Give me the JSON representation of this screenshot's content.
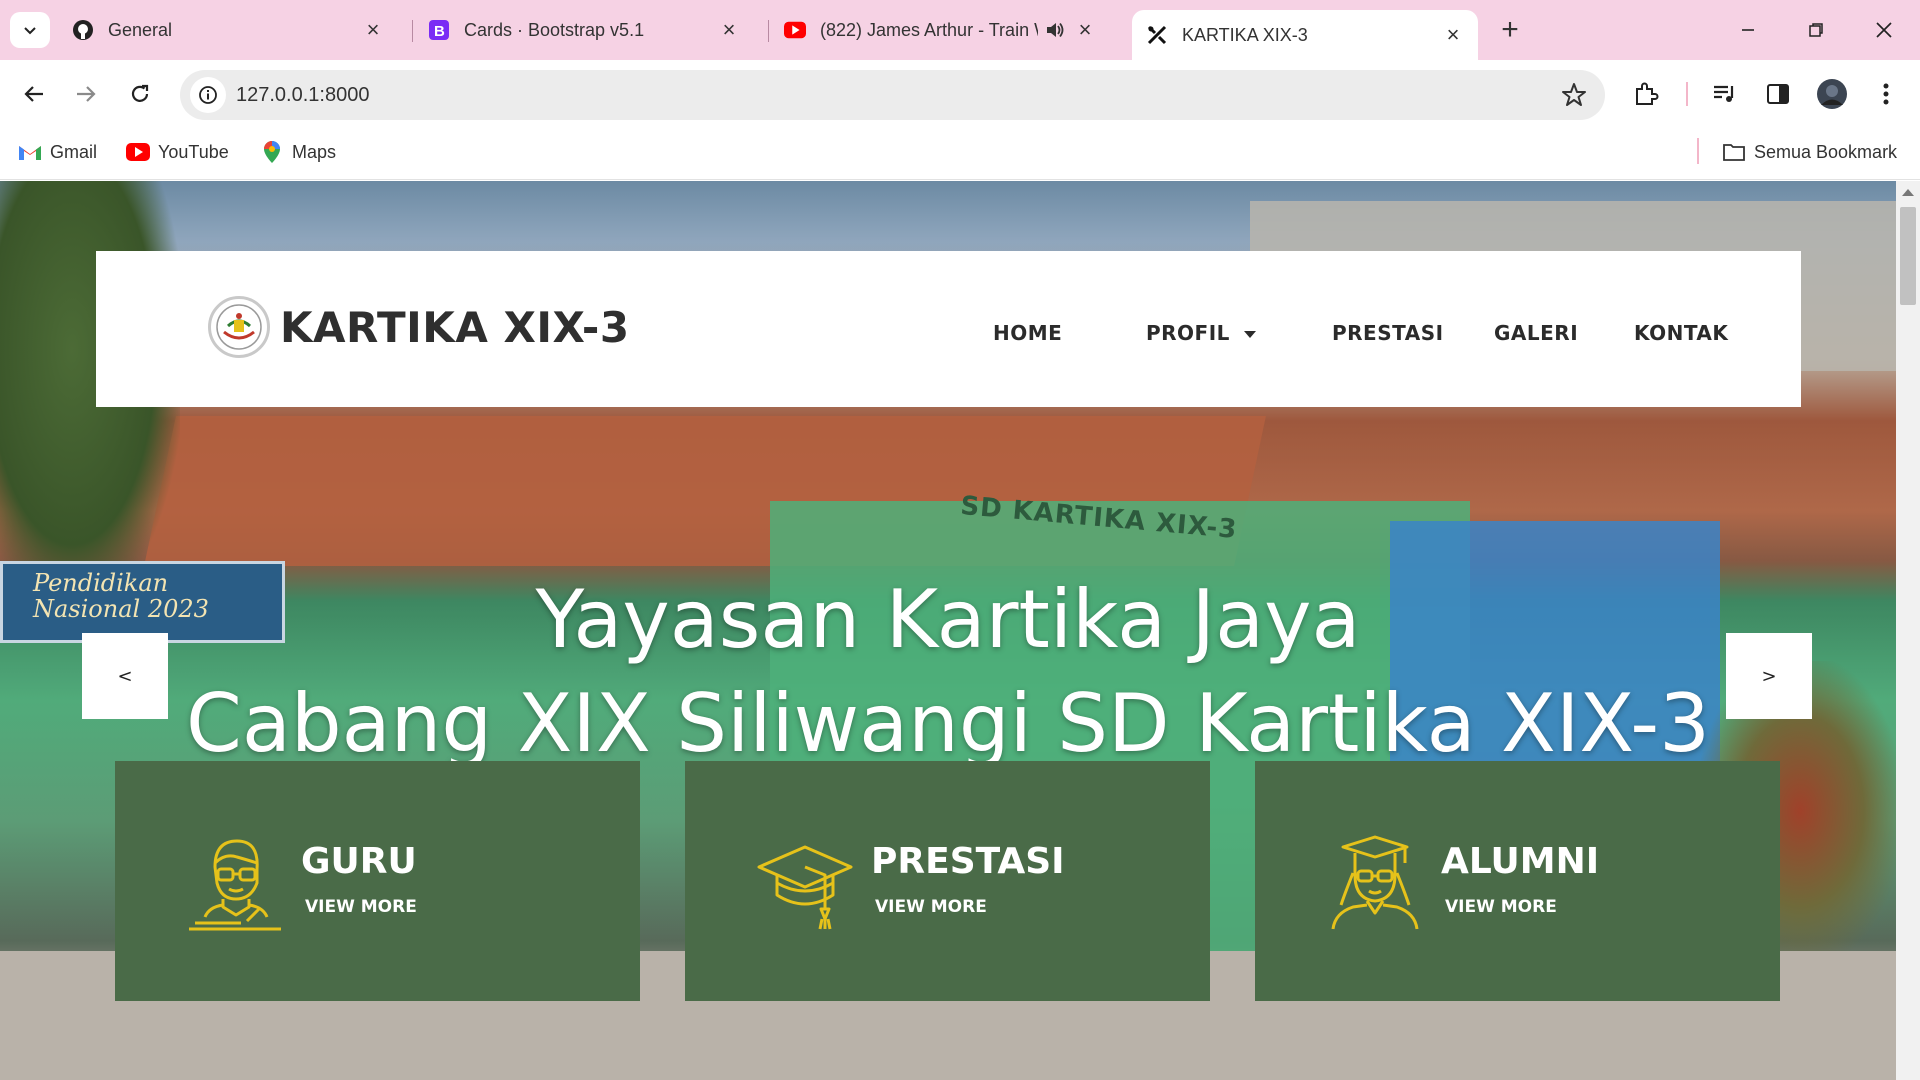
{
  "browser": {
    "tabs": [
      {
        "title": "General",
        "icon": "github-icon",
        "active": false
      },
      {
        "title": "Cards · Bootstrap v5.1",
        "icon": "bootstrap-icon",
        "active": false
      },
      {
        "title": "(822) James Arthur - Train W",
        "icon": "youtube-icon",
        "active": false,
        "audio": true
      },
      {
        "title": "KARTIKA XIX-3",
        "icon": "site-icon",
        "active": true
      }
    ],
    "url": "127.0.0.1:8000",
    "bookmarks": [
      {
        "label": "Gmail",
        "icon": "gmail-icon"
      },
      {
        "label": "YouTube",
        "icon": "youtube-icon"
      },
      {
        "label": "Maps",
        "icon": "maps-icon"
      }
    ],
    "all_bookmarks_label": "Semua Bookmark"
  },
  "site": {
    "brand": "KARTIKA XIX-3",
    "nav": [
      {
        "label": "HOME"
      },
      {
        "label": "PROFIL",
        "dropdown": true
      },
      {
        "label": "PRESTASI"
      },
      {
        "label": "GALERI"
      },
      {
        "label": "KONTAK"
      }
    ],
    "hero": {
      "line1": "Yayasan Kartika Jaya",
      "line2": "Cabang XIX Siliwangi SD Kartika XIX-3",
      "prev": "<",
      "next": ">"
    },
    "background_signs": {
      "school_sign": "SD KARTIKA XIX-3",
      "banner": "Pendidikan Nasional 2023"
    },
    "cards": [
      {
        "title": "GURU",
        "link": "VIEW MORE",
        "icon": "teacher-icon"
      },
      {
        "title": "PRESTASI",
        "link": "VIEW MORE",
        "icon": "graduation-cap-icon"
      },
      {
        "title": "ALUMNI",
        "link": "VIEW MORE",
        "icon": "graduate-icon"
      }
    ],
    "colors": {
      "card_bg": "#4a6b48",
      "icon_gold": "#e6c21a",
      "tabbar_bg": "#f6d2e4"
    }
  }
}
